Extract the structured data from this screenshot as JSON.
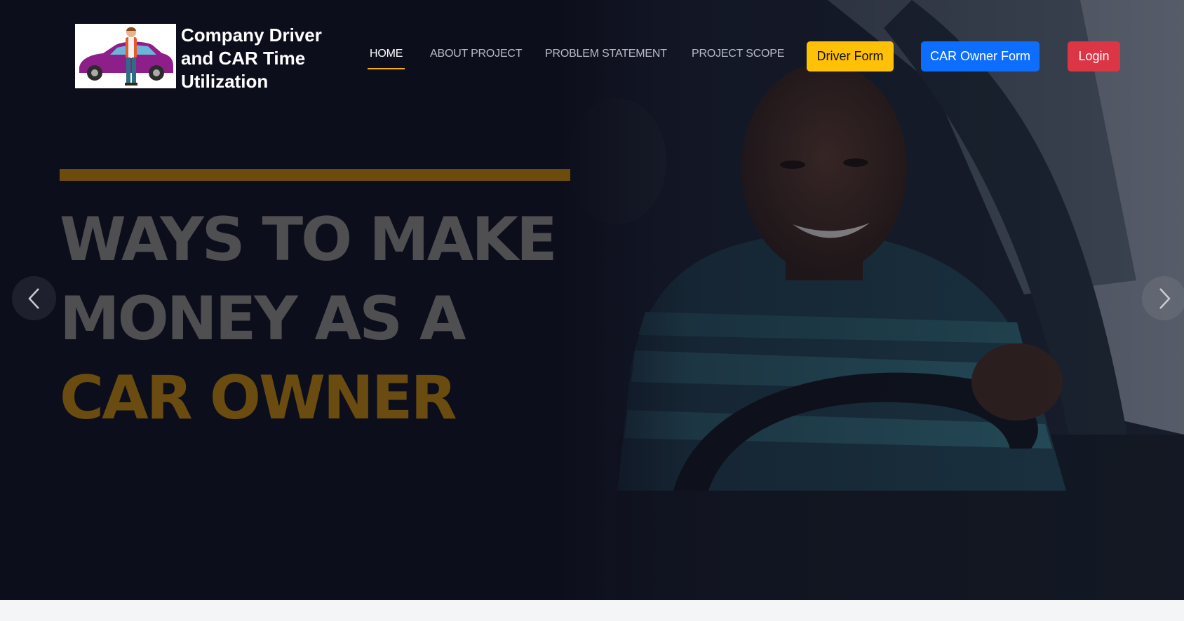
{
  "brand": {
    "title": "Company Driver and CAR Time Utilization",
    "logo_icon": "car-driver-logo"
  },
  "nav": {
    "items": [
      {
        "label": "HOME",
        "active": true
      },
      {
        "label": "ABOUT PROJECT",
        "active": false
      },
      {
        "label": "PROBLEM STATEMENT",
        "active": false
      },
      {
        "label": "PROJECT SCOPE",
        "active": false
      }
    ],
    "active_underline_color": "#f5b00f"
  },
  "buttons": {
    "driver_form": {
      "label": "Driver Form",
      "color": "#ffc107"
    },
    "car_owner_form": {
      "label": "CAR Owner Form",
      "color": "#0d6efd"
    },
    "login": {
      "label": "Login",
      "color": "#dc3545"
    }
  },
  "hero": {
    "lines": [
      "WAYS TO MAKE",
      "MONEY AS A",
      "CAR OWNER"
    ],
    "accent_color": "#f5b00f",
    "prev_icon": "chevron-left-icon",
    "next_icon": "chevron-right-icon"
  }
}
